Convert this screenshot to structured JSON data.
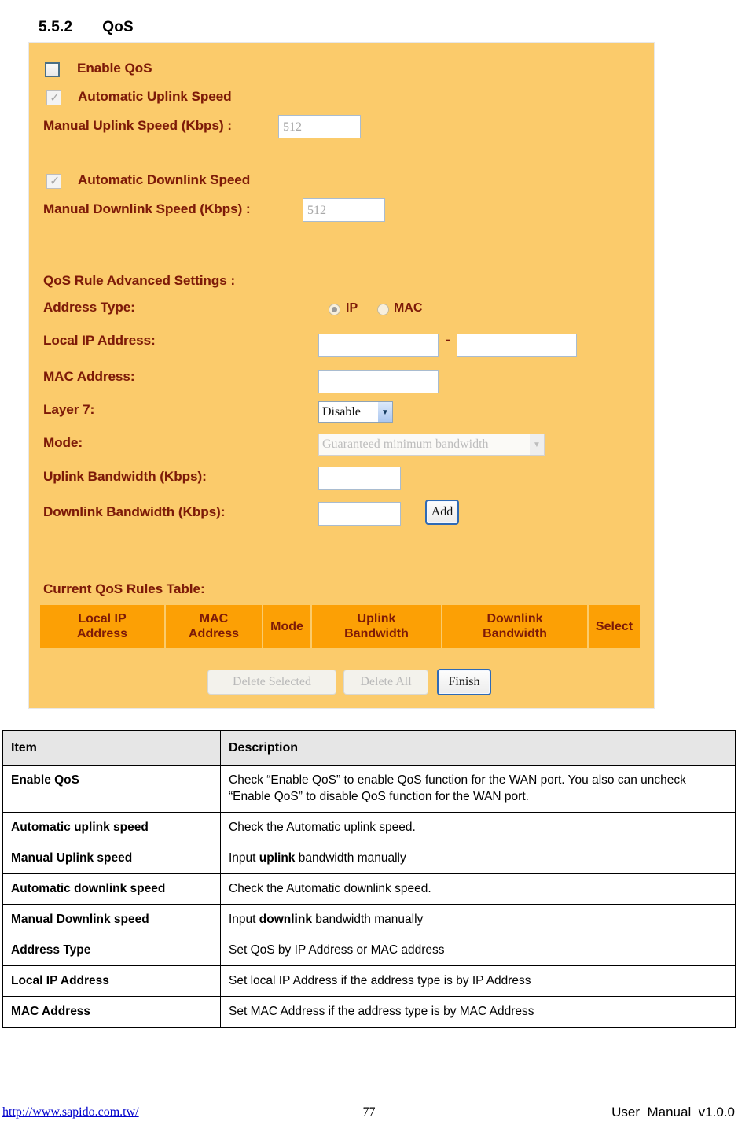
{
  "heading": {
    "number": "5.5.2",
    "title": "QoS"
  },
  "panel": {
    "enable_qos_label": "Enable QoS",
    "auto_uplink_label": "Automatic Uplink Speed",
    "manual_uplink_label": "Manual Uplink Speed (Kbps) :",
    "manual_uplink_value": "512",
    "auto_downlink_label": "Automatic Downlink Speed",
    "manual_downlink_label": "Manual Downlink Speed (Kbps) :",
    "manual_downlink_value": "512",
    "advanced_settings_label": "QoS Rule Advanced Settings :",
    "address_type_label": "Address Type:",
    "address_type_ip": "IP",
    "address_type_mac": "MAC",
    "local_ip_label": "Local IP Address:",
    "local_ip_start": "",
    "local_ip_separator": "-",
    "local_ip_end": "",
    "mac_address_label": "MAC Address:",
    "mac_address_value": "",
    "layer7_label": "Layer 7:",
    "layer7_value": "Disable",
    "mode_label": "Mode:",
    "mode_value": "Guaranteed minimum bandwidth",
    "uplink_bw_label": "Uplink Bandwidth (Kbps):",
    "uplink_bw_value": "",
    "downlink_bw_label": "Downlink Bandwidth (Kbps):",
    "downlink_bw_value": "",
    "add_button": "Add",
    "rules_table_label": "Current QoS Rules Table:",
    "rules_table_headers": [
      "Local IP\nAddress",
      "MAC\nAddress",
      "Mode",
      "Uplink\nBandwidth",
      "Downlink\nBandwidth",
      "Select"
    ],
    "delete_selected_button": "Delete Selected",
    "delete_all_button": "Delete All",
    "finish_button": "Finish",
    "colors": {
      "panel_bg": "#FBCB6B",
      "table_header_bg": "#FCA005",
      "label_text": "#7D1A08"
    }
  },
  "description_table": {
    "headers": [
      "Item",
      "Description"
    ],
    "rows": [
      {
        "item": "Enable QoS",
        "desc": "Check “Enable QoS” to enable QoS function for the WAN port. You also can uncheck “Enable QoS” to disable QoS function for the WAN port."
      },
      {
        "item": "Automatic uplink speed",
        "desc": "Check the Automatic uplink speed."
      },
      {
        "item": "Manual Uplink speed",
        "desc_pre": "Input ",
        "desc_bold": "uplink",
        "desc_post": " bandwidth manually"
      },
      {
        "item": "Automatic downlink speed",
        "desc": "Check the Automatic downlink speed."
      },
      {
        "item": "Manual Downlink speed",
        "desc_pre": "Input ",
        "desc_bold": "downlink",
        "desc_post": " bandwidth manually"
      },
      {
        "item": "Address Type",
        "desc": "Set QoS by IP Address or MAC address"
      },
      {
        "item": "Local IP Address",
        "desc": "Set local IP Address if the address type is by IP Address"
      },
      {
        "item": "MAC Address",
        "desc": "Set MAC Address if the address type is by MAC Address"
      }
    ]
  },
  "footer": {
    "url": "http://www.sapido.com.tw/",
    "page_number": "77",
    "manual": "User  Manual  v1.0.0"
  }
}
